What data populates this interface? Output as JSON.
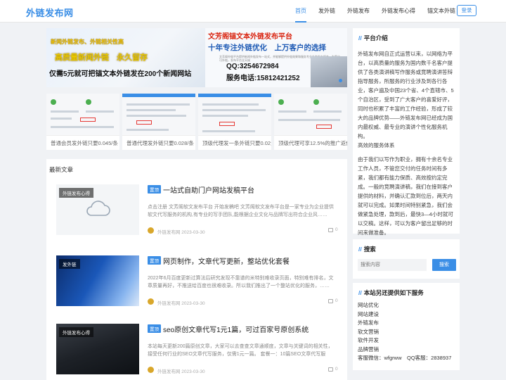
{
  "site": {
    "logo": "外链发布网"
  },
  "nav": {
    "items": [
      {
        "label": "首页",
        "active": true
      },
      {
        "label": "发外链",
        "active": false
      },
      {
        "label": "外链发布",
        "active": false
      },
      {
        "label": "外链发布心得",
        "active": false
      },
      {
        "label": "锚文本外链",
        "active": false
      }
    ],
    "login": "登录"
  },
  "banner": {
    "left_line1": "新闻外链发布、外链相关性高",
    "left_line2": "高质量新闻外链　永久留存",
    "left_line3": "仅需5元就可把锚文本外链发在200个新闻网站",
    "right_title": "文芳阁锚文本外链发布平台",
    "right_slogan": "十年专注外链优化　上万客户的选择",
    "right_small": "文芳阁外链平台提供新闻外链发布一站式，并能够提供外链效果和服务专业外链发布服务，为客户可外链，发布平台全天候",
    "qq": "QQ:3254672984",
    "tel": "服务电话:15812421252"
  },
  "thumbs": [
    {
      "caption": "普通会员发外链只要0.045/条"
    },
    {
      "caption": "普通代理发外链只要0.028/条"
    },
    {
      "caption": "顶级代理发一条外链只要0.02元"
    },
    {
      "caption": "顶级代理可享12.5%的推广返佣"
    }
  ],
  "main": {
    "section_title": "最新文章",
    "articles": [
      {
        "tag": "外链发布心得",
        "badge": "置顶",
        "title": "一站式自助门户网站发稿平台",
        "excerpt": "点击注册 文芳阁软文发布平台 开始发稿吧 文芳阁软文发布平台是一家专业为企业提供软文代写服务的机构,有专业的写手团队,能根据企业文化与品牌写出符合企业风……",
        "author": "外链发布网 2023-03-30",
        "comments": "0"
      },
      {
        "tag": "发外链",
        "badge": "置顶",
        "title": "网页制作，文章代写更新，整站优化套餐",
        "excerpt": "2022年6月百度更新过算法后研究发现不靠谱的米特别难收录页面，特别难有排名，文章质量再好，不推送给百度也很难收录。所以我们推出了一个整站优化的服务，……",
        "author": "外链发布网 2023-03-30",
        "comments": "0"
      },
      {
        "tag": "外链发布心得",
        "badge": "置顶",
        "title": "seo原创文章代写1元1篇，可过百家号原创系统",
        "excerpt": "本站每天更新200篇原创文章，大家可以去查查文章通顺度，文章与关键词的相关性，接受任何行业的SEO文章代写服务，仅需1元一篇。 套餐一：10篇SEO文章代写服",
        "author": "外链发布网 2023-03-30",
        "comments": "0"
      }
    ]
  },
  "sidebar": {
    "intro": {
      "heading": "平台介绍",
      "p1": "外链发布网自正式运营以来，以网络为平台，以高质量的服务为国内数千名客户提供了各类演讲稿写作服务或竞聘演讲答辩指导服务，所服务的行业涉及到各行各业，客户遍及中国23个省、4个直辖市、5个自治区，受到了广大客户的喜爱好评，同时也积累了丰富的工作经验，形成了较大的品牌优势——外链发布网已经成为国内最权威、最专业的演讲个性化服务机构。",
      "p2": "高效的服务体系",
      "p3": "由于我们以写作为职业，拥有十余名专业工作人员，不管您交付的任务时间有多紧，我们都有能力保质、高效按约定完成。一般的竞聘演讲稿，我们在接到客户提供的材料，并确认汇款到位后，两天内就可以完成。如果时间特别紧急，我们会做紧急处理，款到后，最快3—4小时就可以交稿。这样，可以为客户留出足够的时间来做准备。"
    },
    "search": {
      "heading": "搜索",
      "placeholder": "搜索内容",
      "button": "搜索"
    },
    "services": {
      "heading": "本站另还提供如下服务",
      "items": [
        "网站优化",
        "网站建设",
        "外链发布",
        "软文营销",
        "软件开发",
        "品牌营销",
        "客服微信：wfgrww　QQ客服：2838937"
      ]
    }
  }
}
